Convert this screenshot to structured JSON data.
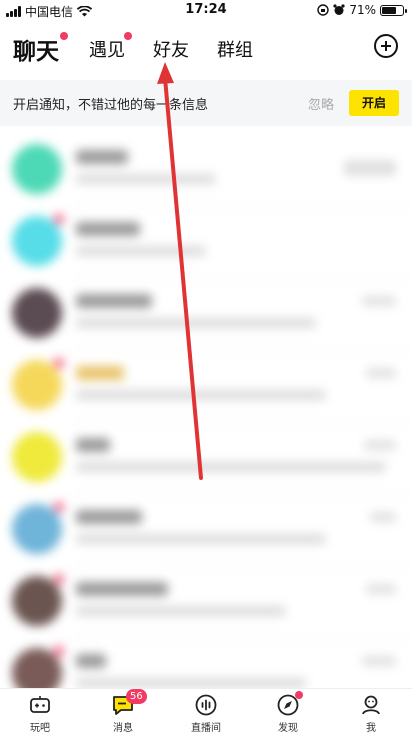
{
  "status_bar": {
    "carrier": "中国电信",
    "time": "17:24",
    "battery": "71%",
    "battery_level": 0.71
  },
  "header": {
    "tabs": [
      {
        "label": "聊天",
        "active": true,
        "dot": true
      },
      {
        "label": "遇见",
        "active": false,
        "dot": true
      },
      {
        "label": "好友",
        "active": false,
        "dot": false
      },
      {
        "label": "群组",
        "active": false,
        "dot": false
      }
    ],
    "add_icon": "plus-circle-icon"
  },
  "notice": {
    "text": "开启通知，不错过他的每一条信息",
    "ignore_label": "忽略",
    "open_label": "开启",
    "accent": "#ffe300"
  },
  "chat_list": {
    "rows": [
      {
        "avatar_color": "#4dd9b6"
      },
      {
        "avatar_color": "#56dde8"
      },
      {
        "avatar_color": "#5b4b52"
      },
      {
        "avatar_color": "#f5d85a"
      },
      {
        "avatar_color": "#f0ea3c"
      },
      {
        "avatar_color": "#6fb4d9"
      },
      {
        "avatar_color": "#6b5550"
      },
      {
        "avatar_color": "#7a5b57"
      }
    ]
  },
  "annotation": {
    "color": "#e03434"
  },
  "bottom_nav": {
    "items": [
      {
        "label": "玩吧",
        "icon": "game-controller-icon"
      },
      {
        "label": "消息",
        "icon": "message-icon",
        "badge": "56"
      },
      {
        "label": "直播间",
        "icon": "live-icon"
      },
      {
        "label": "发现",
        "icon": "compass-icon"
      },
      {
        "label": "我",
        "icon": "profile-icon"
      }
    ]
  }
}
